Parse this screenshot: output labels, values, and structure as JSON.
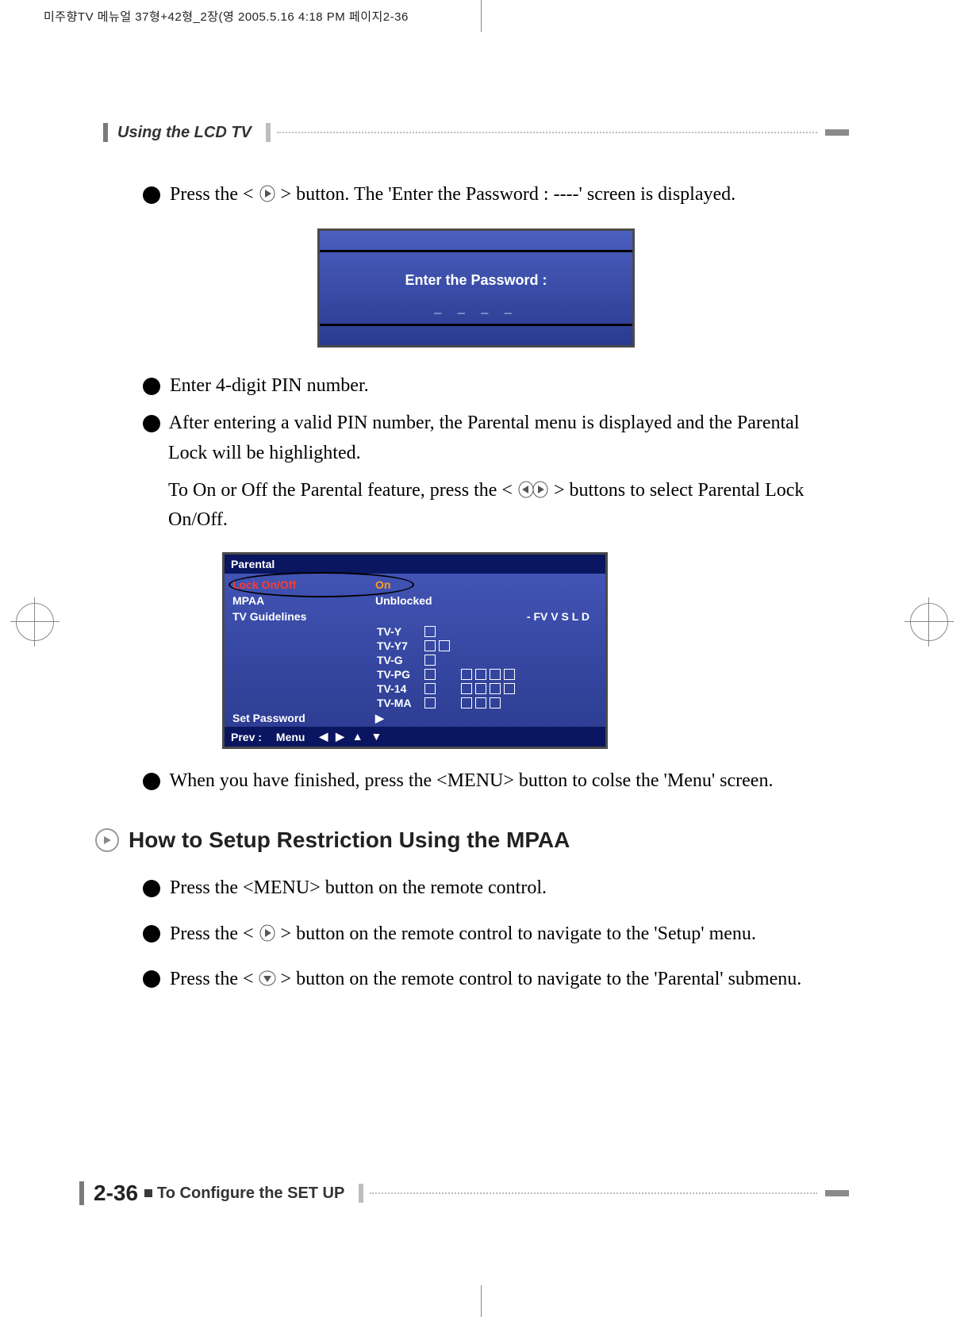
{
  "header_meta": "미주향TV 메뉴얼 37형+42형_2장(영  2005.5.16 4:18 PM  페이지2-36",
  "section_header": "Using the LCD TV",
  "steps": {
    "s4_a": "Press the <",
    "s4_b": "> button. The 'Enter the Password : ----' screen is displayed.",
    "s5": "Enter 4-digit PIN number.",
    "s6_a": "After entering a valid PIN number, the Parental menu is displayed and the Parental Lock will be highlighted.",
    "s6_b_a": "To On or Off the Parental feature, press the <",
    "s6_b_b": "> buttons to select Parental Lock On/Off.",
    "s7": "When you have finished, press the <MENU> button to colse the 'Menu' screen."
  },
  "screen1": {
    "label": "Enter the Password :",
    "blanks": "_  _  _  _"
  },
  "screen2": {
    "title": "Parental",
    "rows": {
      "lock": {
        "label": "Lock On/Off",
        "value": "On"
      },
      "mpaa": {
        "label": "MPAA",
        "value": "Unblocked"
      },
      "tvg": {
        "label": "TV Guidelines",
        "value": "- FV V S L D"
      },
      "setpw": {
        "label": "Set Password",
        "value": "▶"
      }
    },
    "ratings": [
      "TV-Y",
      "TV-Y7",
      "TV-G",
      "TV-PG",
      "TV-14",
      "TV-MA"
    ],
    "footer_prev": "Prev :",
    "footer_menu": "Menu",
    "footer_arrows": "◀ ▶ ▲ ▼"
  },
  "sub_heading": "How to Setup Restriction Using the MPAA",
  "mpaa_steps": {
    "m1": "Press the <MENU> button on the remote control.",
    "m2_a": "Press the < ",
    "m2_b": " > button on the remote control to navigate to the 'Setup' menu.",
    "m3_a": "Press the < ",
    "m3_b": " > button on the remote control to navigate to the 'Parental' submenu."
  },
  "footer": {
    "page": "2-36",
    "text": "To Configure the SET UP"
  }
}
